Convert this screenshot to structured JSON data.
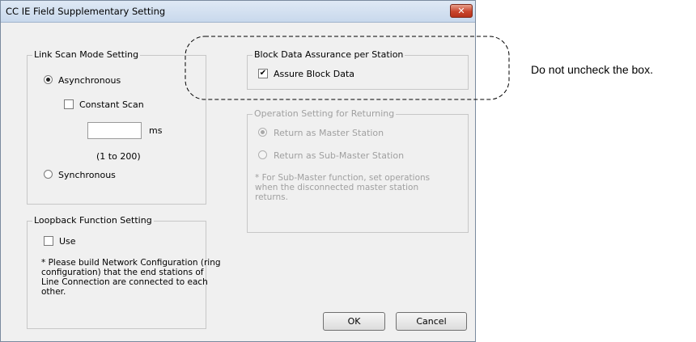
{
  "window": {
    "title": "CC IE Field Supplementary Setting",
    "close_glyph": "✕"
  },
  "link_scan": {
    "legend": "Link Scan Mode Setting",
    "asynchronous": "Asynchronous",
    "asynchronous_selected": true,
    "constant_scan": "Constant Scan",
    "constant_scan_checked": false,
    "scan_value": "",
    "unit": "ms",
    "range": "(1 to 200)",
    "synchronous": "Synchronous"
  },
  "loopback": {
    "legend": "Loopback Function Setting",
    "use": "Use",
    "use_checked": false,
    "note_lines": [
      "* Please build Network Configuration (ring",
      "configuration) that the end stations of",
      "Line Connection are connected to each",
      "other."
    ]
  },
  "block_data": {
    "legend": "Block Data Assurance per Station",
    "assure": "Assure Block Data",
    "assure_checked": true
  },
  "returning": {
    "legend": "Operation Setting for Returning",
    "master": "Return as Master Station",
    "master_selected": true,
    "submaster": "Return as Sub-Master Station",
    "note_lines": [
      "* For Sub-Master function, set operations",
      "when the disconnected master station",
      "returns."
    ]
  },
  "buttons": {
    "ok": "OK",
    "cancel": "Cancel"
  },
  "annotation": "Do not uncheck the box.",
  "colors": {
    "disabled_text": "#a0a0a0",
    "title_gradient": "#c8d8ec",
    "close_red": "#c9452d"
  }
}
